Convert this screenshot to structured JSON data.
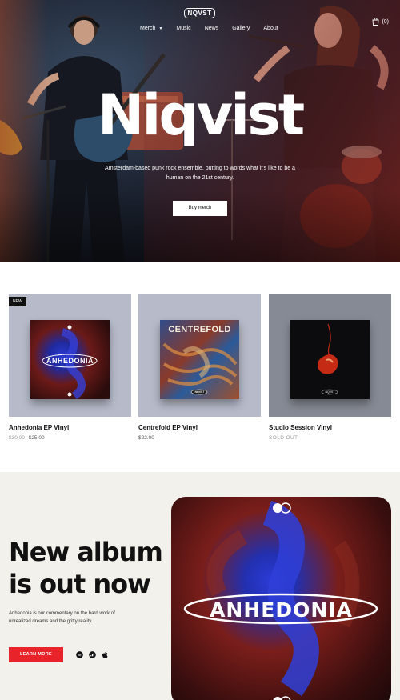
{
  "header": {
    "logo": "NQVST",
    "nav": [
      {
        "label": "Merch",
        "has_dropdown": true
      },
      {
        "label": "Music"
      },
      {
        "label": "News"
      },
      {
        "label": "Gallery"
      },
      {
        "label": "About"
      }
    ],
    "cart_count": "(0)"
  },
  "hero": {
    "title": "Niqvist",
    "subtitle": "Amsterdam-based punk rock ensemble, putting to words what it's like to be a human on the 21st century.",
    "cta": "Buy merch"
  },
  "products": [
    {
      "badge": "NEW",
      "name": "Anhedonia EP Vinyl",
      "old_price": "$30.00",
      "price": "$25.00",
      "cover_text": "ANHEDONIA",
      "bg": "#b7bac9"
    },
    {
      "badge": "",
      "name": "Centrefold EP Vinyl",
      "old_price": "",
      "price": "$22.00",
      "cover_text": "CENTREFOLD",
      "cover_logo": "NQVST",
      "bg": "#b7bac9"
    },
    {
      "badge": "",
      "name": "Studio Session Vinyl",
      "old_price": "",
      "price": "SOLD OUT",
      "cover_logo": "NQVST",
      "bg": "#868a94"
    }
  ],
  "promo": {
    "title_line1": "New album",
    "title_line2": "is out now",
    "description": "Anhedonia is our commentary on the hard work of unrealized dreams and the gritty reality.",
    "cta": "LEARN MORE",
    "album_text": "ANHEDONIA",
    "streaming_icons": [
      "spotify-icon",
      "deezer-icon",
      "apple-icon"
    ]
  },
  "colors": {
    "accent_red": "#e8242a",
    "promo_bg": "#f2f1ec",
    "card_bg": "#b7bac9"
  }
}
